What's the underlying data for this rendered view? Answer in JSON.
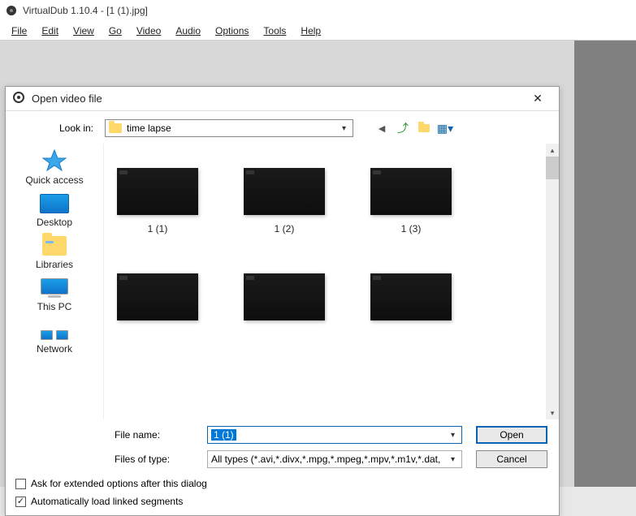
{
  "app": {
    "title": "VirtualDub 1.10.4 - [1 (1).jpg]",
    "menu": [
      "File",
      "Edit",
      "View",
      "Go",
      "Video",
      "Audio",
      "Options",
      "Tools",
      "Help"
    ]
  },
  "dialog": {
    "title": "Open video file",
    "lookin_label": "Look in:",
    "lookin_value": "time lapse",
    "places": [
      {
        "label": "Quick access"
      },
      {
        "label": "Desktop"
      },
      {
        "label": "Libraries"
      },
      {
        "label": "This PC"
      },
      {
        "label": "Network"
      }
    ],
    "files": [
      {
        "name": "1 (1)"
      },
      {
        "name": "1 (2)"
      },
      {
        "name": "1 (3)"
      },
      {
        "name": ""
      },
      {
        "name": ""
      },
      {
        "name": ""
      }
    ],
    "filename_label": "File name:",
    "filename_value": "1 (1)",
    "filetype_label": "Files of type:",
    "filetype_value": "All types (*.avi,*.divx,*.mpg,*.mpeg,*.mpv,*.m1v,*.dat,",
    "open_btn": "Open",
    "cancel_btn": "Cancel",
    "checkbox1": "Ask for extended options after this dialog",
    "checkbox2": "Automatically load linked segments"
  }
}
